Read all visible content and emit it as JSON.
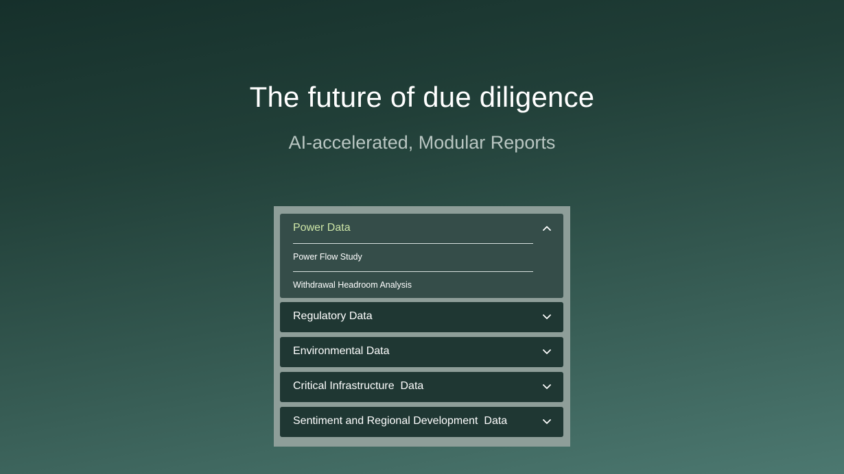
{
  "hero": {
    "title": "The future of due diligence",
    "subtitle": "AI-accelerated, Modular Reports"
  },
  "accordion": {
    "items": [
      {
        "label": "Power Data",
        "expanded": true,
        "icon": "chevron-up-icon",
        "sub_items": [
          {
            "label": "Power Flow Study"
          },
          {
            "label": "Withdrawal Headroom Analysis"
          }
        ]
      },
      {
        "label": "Regulatory Data",
        "expanded": false,
        "icon": "chevron-down-icon"
      },
      {
        "label": "Environmental Data",
        "expanded": false,
        "icon": "chevron-down-icon"
      },
      {
        "label": "Critical Infrastructure  Data",
        "expanded": false,
        "icon": "chevron-down-icon"
      },
      {
        "label": "Sentiment and Regional Development  Data",
        "expanded": false,
        "icon": "chevron-down-icon"
      }
    ]
  },
  "colors": {
    "accent_label": "#cfe7a8",
    "item_bg": "#1f3733",
    "item_open_bg": "#354d49",
    "panel_frame": "#8e9e99"
  }
}
